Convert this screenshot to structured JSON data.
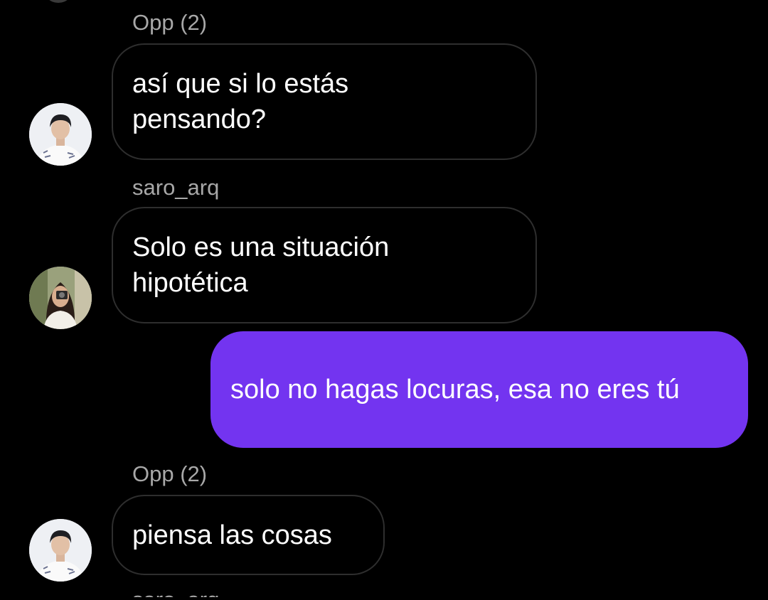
{
  "messages": [
    {
      "sender": "Opp (2)",
      "text": "así que si lo estás pensando?",
      "direction": "incoming",
      "avatar": "avatar-man-icon"
    },
    {
      "sender": "saro_arq",
      "text": "Solo es una situación hipotética",
      "direction": "incoming",
      "avatar": "avatar-woman-camera-icon"
    },
    {
      "text": "solo no hagas locuras, esa no eres tú",
      "direction": "outgoing"
    },
    {
      "sender": "Opp (2)",
      "text": "piensa las cosas",
      "direction": "incoming",
      "avatar": "avatar-man-icon"
    }
  ],
  "next_sender": "saro_arq",
  "colors": {
    "background": "#000000",
    "outgoing_bubble": "#7334f0",
    "incoming_border": "#2e2e2e",
    "sender_text": "#a8a8a8",
    "message_text": "#ffffff"
  }
}
